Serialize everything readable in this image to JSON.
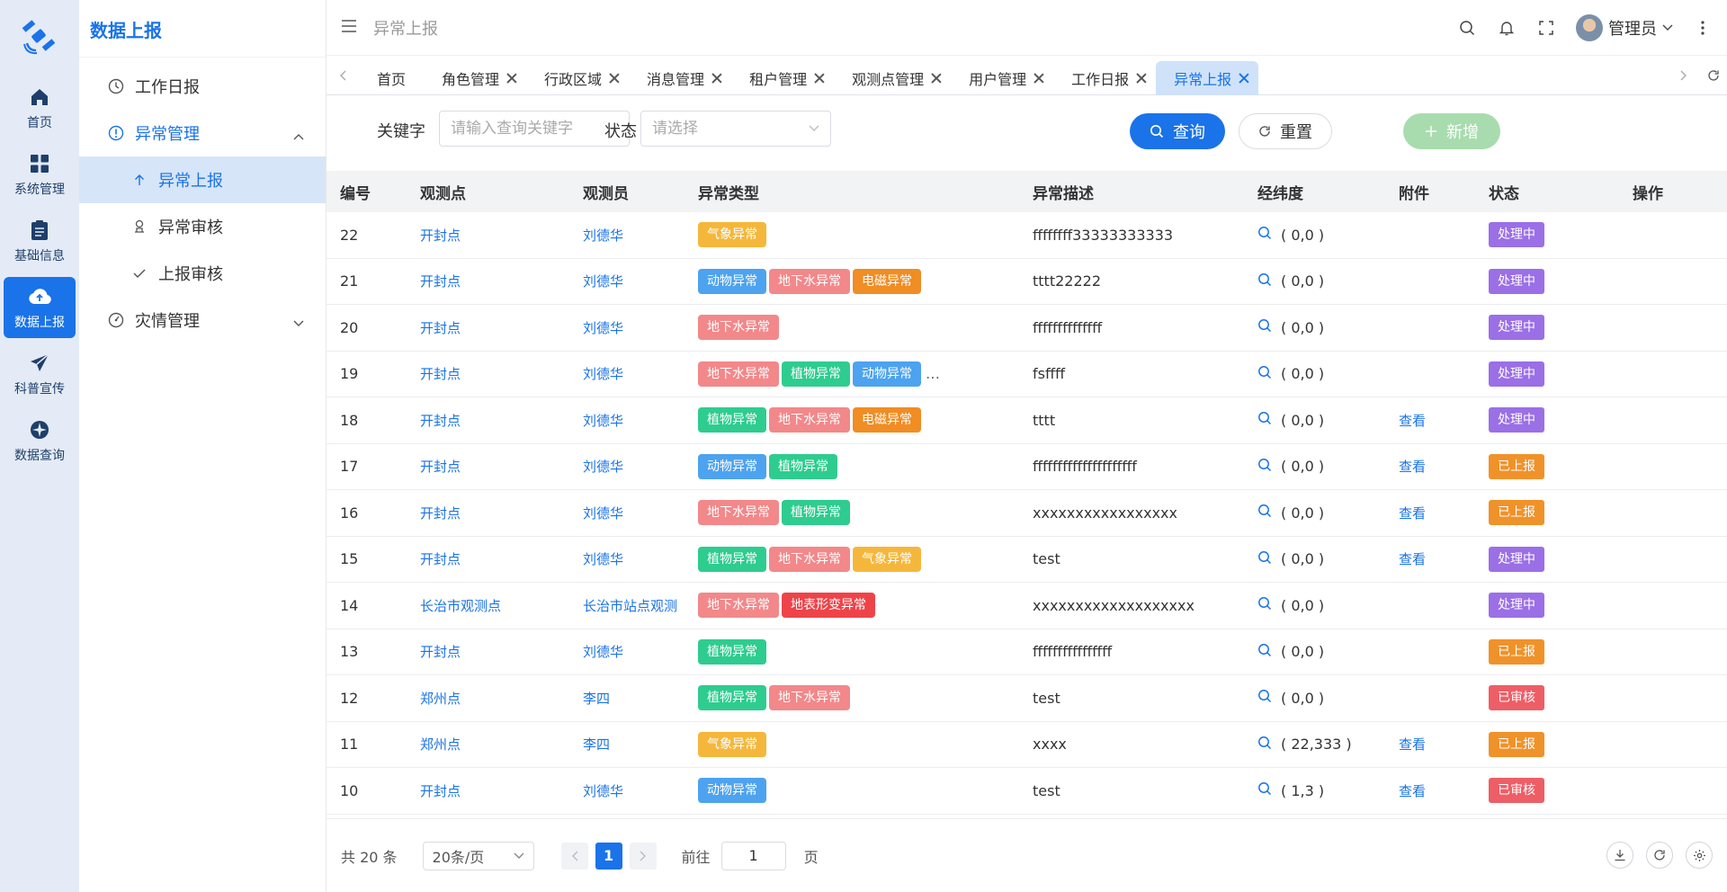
{
  "rail": {
    "items": [
      {
        "label": "首页",
        "icon": "home-icon"
      },
      {
        "label": "系统管理",
        "icon": "grid-icon"
      },
      {
        "label": "基础信息",
        "icon": "clipboard-icon"
      },
      {
        "label": "数据上报",
        "icon": "cloud-upload-icon",
        "active": true
      },
      {
        "label": "科普宣传",
        "icon": "paper-plane-icon"
      },
      {
        "label": "数据查询",
        "icon": "compass-icon"
      }
    ]
  },
  "submenu": {
    "title": "数据上报",
    "items": [
      {
        "label": "工作日报"
      },
      {
        "label": "异常管理"
      },
      {
        "label": "异常上报"
      },
      {
        "label": "异常审核"
      },
      {
        "label": "上报审核"
      },
      {
        "label": "灾情管理"
      }
    ]
  },
  "header": {
    "title": "异常上报",
    "user": "管理员"
  },
  "tabs": [
    "首页",
    "角色管理",
    "行政区域",
    "消息管理",
    "租户管理",
    "观测点管理",
    "用户管理",
    "工作日报",
    "异常上报"
  ],
  "filter": {
    "keyword_label": "关键字",
    "keyword_placeholder": "请输入查询关键字",
    "status_label": "状态",
    "status_placeholder": "请选择",
    "query": "查询",
    "reset": "重置",
    "add": "新增"
  },
  "colors": {
    "primary": "#1a73e8",
    "tag_qixiang": "#f5b73b",
    "tag_dongwu": "#4da3ef",
    "tag_dixiashui": "#f2888a",
    "tag_dianci": "#f08d24",
    "tag_zhiwu": "#2ecc8f",
    "tag_dibiao": "#ee4449",
    "status_processing": "#9b6fe6",
    "status_reported": "#f0922a",
    "status_audited": "#ee5e66"
  },
  "table": {
    "headers": [
      "编号",
      "观测点",
      "观测员",
      "异常类型",
      "异常描述",
      "经纬度",
      "附件",
      "状态",
      "操作"
    ],
    "rows": [
      {
        "id": "22",
        "point": "开封点",
        "observer": "刘德华",
        "types": [
          "气象异常"
        ],
        "more": "",
        "desc": "ffffffff33333333333",
        "ll": "( 0,0 )",
        "att": "",
        "status": "处理中"
      },
      {
        "id": "21",
        "point": "开封点",
        "observer": "刘德华",
        "types": [
          "动物异常",
          "地下水异常",
          "电磁异常"
        ],
        "more": "",
        "desc": "tttt22222",
        "ll": "( 0,0 )",
        "att": "",
        "status": "处理中"
      },
      {
        "id": "20",
        "point": "开封点",
        "observer": "刘德华",
        "types": [
          "地下水异常"
        ],
        "more": "",
        "desc": "ffffffffffffff",
        "ll": "( 0,0 )",
        "att": "",
        "status": "处理中"
      },
      {
        "id": "19",
        "point": "开封点",
        "observer": "刘德华",
        "types": [
          "地下水异常",
          "植物异常",
          "动物异常"
        ],
        "more": "…",
        "desc": "fsffff",
        "ll": "( 0,0 )",
        "att": "",
        "status": "处理中"
      },
      {
        "id": "18",
        "point": "开封点",
        "observer": "刘德华",
        "types": [
          "植物异常",
          "地下水异常",
          "电磁异常"
        ],
        "more": "",
        "desc": "tttt",
        "ll": "( 0,0 )",
        "att": "查看",
        "status": "处理中"
      },
      {
        "id": "17",
        "point": "开封点",
        "observer": "刘德华",
        "types": [
          "动物异常",
          "植物异常"
        ],
        "more": "",
        "desc": "fffffffffffffffffffff",
        "ll": "( 0,0 )",
        "att": "查看",
        "status": "已上报"
      },
      {
        "id": "16",
        "point": "开封点",
        "observer": "刘德华",
        "types": [
          "地下水异常",
          "植物异常"
        ],
        "more": "",
        "desc": "xxxxxxxxxxxxxxxxx",
        "ll": "( 0,0 )",
        "att": "查看",
        "status": "已上报"
      },
      {
        "id": "15",
        "point": "开封点",
        "observer": "刘德华",
        "types": [
          "植物异常",
          "地下水异常",
          "气象异常"
        ],
        "more": "",
        "desc": "test",
        "ll": "( 0,0 )",
        "att": "查看",
        "status": "处理中"
      },
      {
        "id": "14",
        "point": "长治市观测点",
        "observer": "长治市站点观测",
        "types": [
          "地下水异常",
          "地表形变异常"
        ],
        "more": "",
        "desc": "xxxxxxxxxxxxxxxxxxx",
        "ll": "( 0,0 )",
        "att": "",
        "status": "处理中"
      },
      {
        "id": "13",
        "point": "开封点",
        "observer": "刘德华",
        "types": [
          "植物异常"
        ],
        "more": "",
        "desc": "ffffffffffffffff",
        "ll": "( 0,0 )",
        "att": "",
        "status": "已上报"
      },
      {
        "id": "12",
        "point": "郑州点",
        "observer": "李四",
        "types": [
          "植物异常",
          "地下水异常"
        ],
        "more": "",
        "desc": "test",
        "ll": "( 0,0 )",
        "att": "",
        "status": "已审核"
      },
      {
        "id": "11",
        "point": "郑州点",
        "observer": "李四",
        "types": [
          "气象异常"
        ],
        "more": "",
        "desc": "xxxx",
        "ll": "( 22,333 )",
        "att": "查看",
        "status": "已上报"
      },
      {
        "id": "10",
        "point": "开封点",
        "observer": "刘德华",
        "types": [
          "动物异常"
        ],
        "more": "",
        "desc": "test",
        "ll": "( 1,3 )",
        "att": "查看",
        "status": "已审核"
      }
    ]
  },
  "pager": {
    "total": "共 20 条",
    "size": "20条/页",
    "current": "1",
    "goto_label": "前往",
    "goto_value": "1",
    "page_unit": "页"
  }
}
